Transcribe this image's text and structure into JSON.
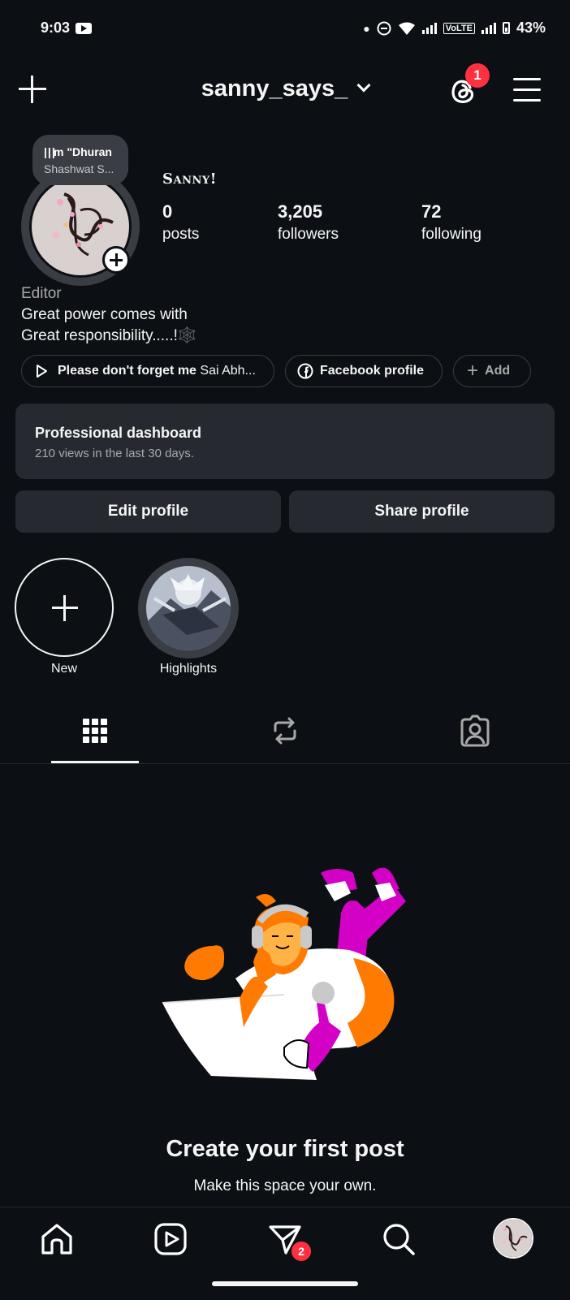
{
  "status_bar": {
    "time": "9:03",
    "network": "VoLTE",
    "battery": "43%",
    "icons": [
      "youtube-icon",
      "dnd-icon",
      "data-arrows-icon",
      "wifi-icon",
      "signal-icon",
      "signal-icon",
      "battery-icon"
    ]
  },
  "header": {
    "username": "sanny_says_",
    "threads_badge": "1"
  },
  "note": {
    "line1": "m \"Dhuran",
    "line2": "Shashwat S..."
  },
  "profile": {
    "display_name": "Sanny!",
    "stats": [
      {
        "value": "0",
        "label": "posts"
      },
      {
        "value": "3,205",
        "label": "followers"
      },
      {
        "value": "72",
        "label": "following"
      }
    ],
    "category": "Editor",
    "bio_line1": "Great power comes with",
    "bio_line2": "Great responsibility.....!🕸️"
  },
  "chips": {
    "music_title": "Please don't forget me",
    "music_artist": "Sai Abh...",
    "facebook": "Facebook profile",
    "add": "Add"
  },
  "dashboard": {
    "title": "Professional dashboard",
    "subtitle": "210 views in the last 30 days."
  },
  "buttons": {
    "edit": "Edit profile",
    "share": "Share profile"
  },
  "highlights": [
    {
      "label": "New"
    },
    {
      "label": "Highlights"
    }
  ],
  "tabs": [
    "grid-icon",
    "reposts-icon",
    "tagged-icon"
  ],
  "empty_state": {
    "title": "Create your first post",
    "subtitle": "Make this space your own."
  },
  "bottom_nav": {
    "items": [
      "home-icon",
      "reels-icon",
      "messages-icon",
      "search-icon",
      "profile-avatar"
    ],
    "messages_badge": "2"
  },
  "colors": {
    "background": "#0c1014",
    "surface": "#262a30",
    "badge": "#ff3040",
    "illustration_orange": "#ff7a00",
    "illustration_magenta": "#d300c5"
  }
}
